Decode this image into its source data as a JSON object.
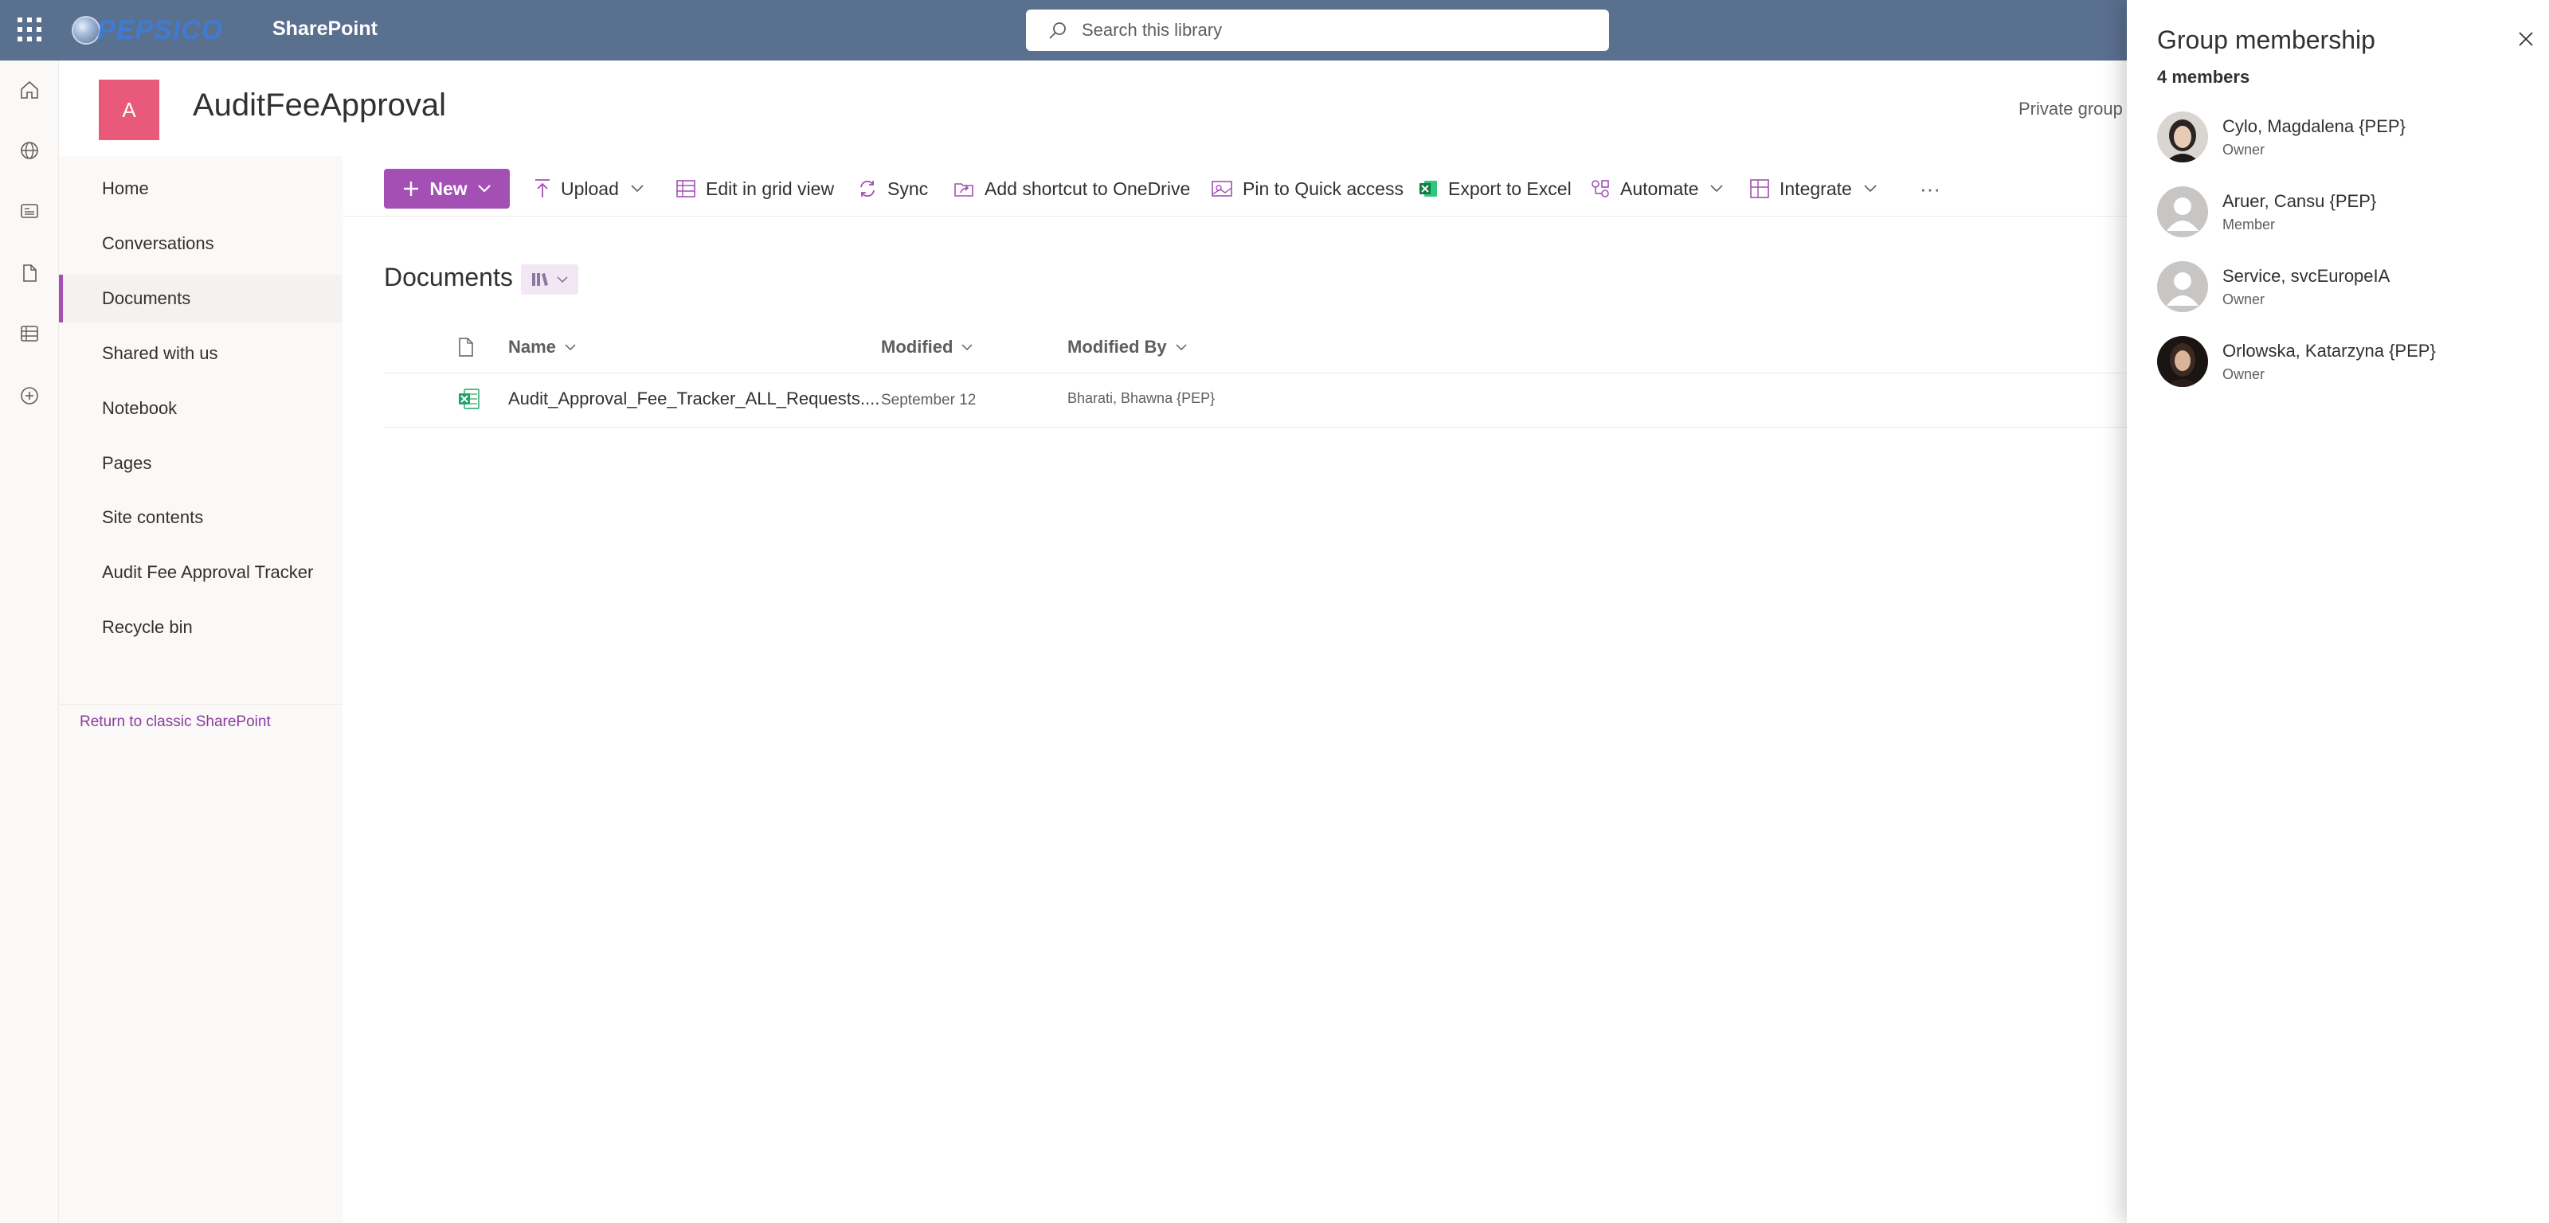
{
  "suite": {
    "logo_text": "PEPSICO",
    "app_name": "SharePoint",
    "search_placeholder": "Search this library"
  },
  "site": {
    "logo_letter": "A",
    "title": "AuditFeeApproval",
    "privacy": "Private group",
    "logo_color": "#e9597a"
  },
  "nav": {
    "items": [
      {
        "label": "Home"
      },
      {
        "label": "Conversations"
      },
      {
        "label": "Documents",
        "selected": true
      },
      {
        "label": "Shared with us"
      },
      {
        "label": "Notebook"
      },
      {
        "label": "Pages"
      },
      {
        "label": "Site contents"
      },
      {
        "label": "Audit Fee Approval Tracker"
      },
      {
        "label": "Recycle bin"
      }
    ],
    "classic_link": "Return to classic SharePoint"
  },
  "commands": {
    "new": "New",
    "upload": "Upload",
    "grid": "Edit in grid view",
    "sync": "Sync",
    "shortcut": "Add shortcut to OneDrive",
    "pin": "Pin to Quick access",
    "export": "Export to Excel",
    "automate": "Automate",
    "integrate": "Integrate",
    "more": "···"
  },
  "library": {
    "title": "Documents",
    "columns": {
      "name": "Name",
      "modified": "Modified",
      "modified_by": "Modified By"
    },
    "files": [
      {
        "name": "Audit_Approval_Fee_Tracker_ALL_Requests....",
        "modified": "September 12",
        "modified_by": "Bharati, Bhawna {PEP}",
        "type": "excel"
      }
    ]
  },
  "panel": {
    "title": "Group membership",
    "count": "4 members",
    "members": [
      {
        "name": "Cylo, Magdalena {PEP}",
        "role": "Owner",
        "photo": true
      },
      {
        "name": "Aruer, Cansu {PEP}",
        "role": "Member",
        "photo": false
      },
      {
        "name": "Service, svcEuropeIA",
        "role": "Owner",
        "photo": false
      },
      {
        "name": "Orlowska, Katarzyna {PEP}",
        "role": "Owner",
        "photo": true
      }
    ]
  },
  "colors": {
    "accent": "#a34fb3",
    "suitebar": "#5a708f"
  }
}
